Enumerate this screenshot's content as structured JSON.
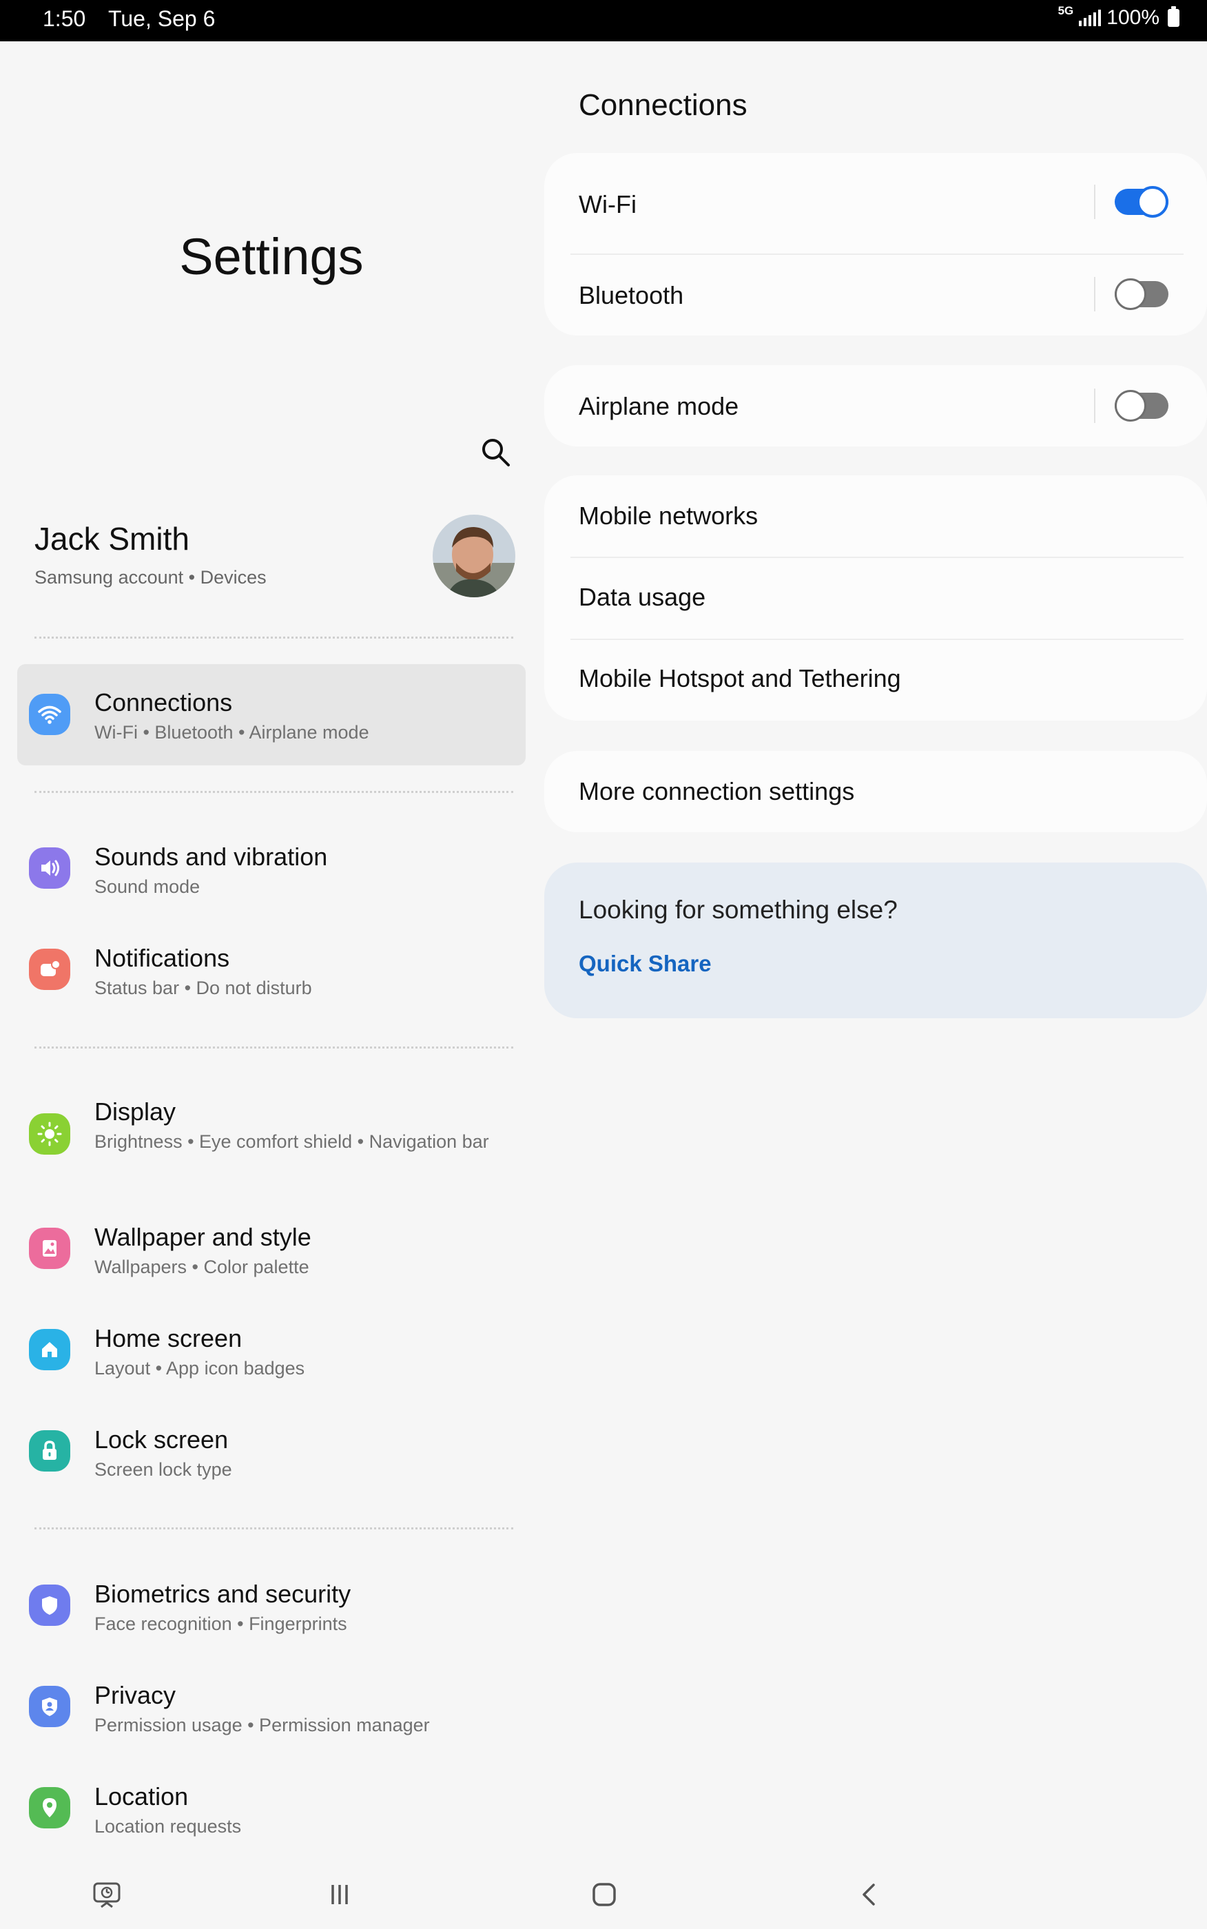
{
  "status_bar": {
    "time": "1:50",
    "date": "Tue, Sep 6",
    "network": "5G",
    "battery": "100%"
  },
  "left": {
    "title": "Settings",
    "search_icon": "search-icon",
    "profile": {
      "name": "Jack Smith",
      "sub": "Samsung account  •  Devices"
    },
    "items": [
      {
        "title": "Connections",
        "sub": "Wi-Fi  •  Bluetooth  •  Airplane mode",
        "icon": "wifi-icon",
        "color": "#4f9cf6"
      },
      {
        "title": "Sounds and vibration",
        "sub": "Sound mode",
        "icon": "speaker-icon",
        "color": "#8c78ea"
      },
      {
        "title": "Notifications",
        "sub": "Status bar  •  Do not disturb",
        "icon": "notification-icon",
        "color": "#f07567"
      },
      {
        "title": "Display",
        "sub": "Brightness  •  Eye comfort shield  •  Navigation bar",
        "icon": "sun-icon",
        "color": "#8ad133"
      },
      {
        "title": "Wallpaper and style",
        "sub": "Wallpapers  •  Color palette",
        "icon": "wallpaper-icon",
        "color": "#ec6c9c"
      },
      {
        "title": "Home screen",
        "sub": "Layout  •  App icon badges",
        "icon": "home-icon",
        "color": "#2ab2e6"
      },
      {
        "title": "Lock screen",
        "sub": "Screen lock type",
        "icon": "lock-icon",
        "color": "#26b3a4"
      },
      {
        "title": "Biometrics and security",
        "sub": "Face recognition  •  Fingerprints",
        "icon": "shield-icon",
        "color": "#6f7cee"
      },
      {
        "title": "Privacy",
        "sub": "Permission usage  •  Permission manager",
        "icon": "privacy-shield-icon",
        "color": "#5d86ec"
      },
      {
        "title": "Location",
        "sub": "Location requests",
        "icon": "location-pin-icon",
        "color": "#54bb54"
      }
    ]
  },
  "right": {
    "title": "Connections",
    "wifi": {
      "label": "Wi-Fi",
      "enabled": true
    },
    "bluetooth": {
      "label": "Bluetooth",
      "enabled": false
    },
    "airplane": {
      "label": "Airplane mode",
      "enabled": false
    },
    "mobile_networks": "Mobile networks",
    "data_usage": "Data usage",
    "hotspot": "Mobile Hotspot and Tethering",
    "more": "More connection settings",
    "suggest": {
      "question": "Looking for something else?",
      "link": "Quick Share"
    }
  },
  "nav": {
    "icons": [
      "screen-recorder-icon",
      "recent-apps-icon",
      "home-button-icon",
      "back-icon"
    ]
  },
  "colors": {
    "accent": "#1a6fe8",
    "link": "#1565c0",
    "selected_bg": "#e6e6e6"
  }
}
